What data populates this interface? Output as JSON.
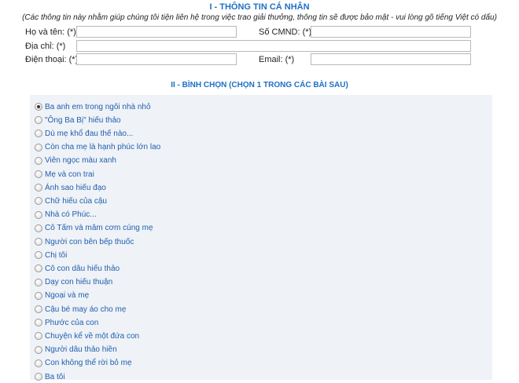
{
  "personal": {
    "title": "I - THÔNG TIN CÁ NHÂN",
    "note": "(Các thông tin này nhằm giúp chúng tôi tiện liên hệ trong việc trao giải thưởng, thông tin sẽ được bảo mật - vui lòng gõ tiếng Việt có dấu)",
    "fullname_label": "Họ và tên: (*)",
    "fullname_value": "",
    "idcard_label": "Số CMND: (*)",
    "idcard_value": "",
    "address_label": "Địa chỉ: (*)",
    "address_value": "",
    "phone_label": "Điện thoại: (*)",
    "phone_value": "",
    "email_label": "Email: (*)",
    "email_value": ""
  },
  "vote": {
    "title": "II - BÌNH CHỌN (CHỌN 1 TRONG CÁC BÀI SAU)",
    "selected_index": 0,
    "options": [
      "Ba anh em trong ngôi nhà nhỏ",
      "\"Ông Ba Bị\" hiếu thảo",
      "Dù mẹ khổ đau thế nào...",
      "Còn cha mẹ là hạnh phúc lớn lao",
      "Viên ngọc màu xanh",
      " Mẹ và con trai",
      "Ánh sao hiếu đạo",
      "Chữ hiếu của cậu",
      "Nhà có Phúc...",
      "Cô Tấm và mâm cơm cúng mẹ",
      "Người con bên bếp thuốc",
      "Chị tôi",
      "Cô con dâu hiếu thảo",
      "Dạy con hiếu thuận",
      "Ngoại và mẹ",
      "Cậu bé may áo cho mẹ",
      "Phước của con",
      "Chuyện kể về một đứa con",
      "Người dâu thảo hiền",
      "Con không thể rời bỏ mẹ",
      "Ba tôi"
    ]
  }
}
